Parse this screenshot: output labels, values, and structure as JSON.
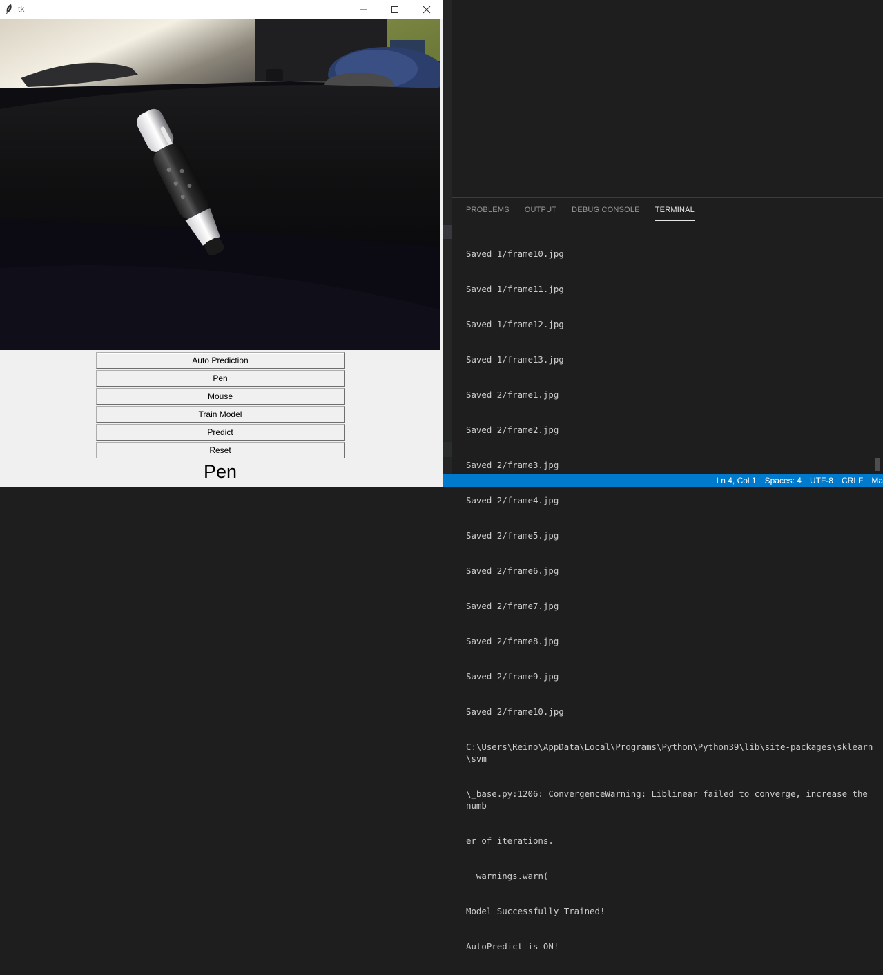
{
  "tk_window": {
    "title": "tk",
    "controls": {
      "minimize": "minimize",
      "maximize": "maximize",
      "close": "close"
    },
    "buttons": [
      {
        "label": "Auto Prediction"
      },
      {
        "label": "Pen"
      },
      {
        "label": "Mouse"
      },
      {
        "label": "Train Model"
      },
      {
        "label": "Predict"
      },
      {
        "label": "Reset"
      }
    ],
    "prediction_label": "Pen",
    "camera_feed": "webcam-preview-pen-on-desk"
  },
  "vscode": {
    "panel_tabs": [
      {
        "label": "PROBLEMS",
        "active": false
      },
      {
        "label": "OUTPUT",
        "active": false
      },
      {
        "label": "DEBUG CONSOLE",
        "active": false
      },
      {
        "label": "TERMINAL",
        "active": true
      }
    ],
    "terminal_lines": [
      "Saved 1/frame10.jpg",
      "Saved 1/frame11.jpg",
      "Saved 1/frame12.jpg",
      "Saved 1/frame13.jpg",
      "Saved 2/frame1.jpg",
      "Saved 2/frame2.jpg",
      "Saved 2/frame3.jpg",
      "Saved 2/frame4.jpg",
      "Saved 2/frame5.jpg",
      "Saved 2/frame6.jpg",
      "Saved 2/frame7.jpg",
      "Saved 2/frame8.jpg",
      "Saved 2/frame9.jpg",
      "Saved 2/frame10.jpg",
      "C:\\Users\\Reino\\AppData\\Local\\Programs\\Python\\Python39\\lib\\site-packages\\sklearn\\svm",
      "\\_base.py:1206: ConvergenceWarning: Liblinear failed to converge, increase the numb",
      "er of iterations.",
      "  warnings.warn(",
      "Model Successfully Trained!",
      "AutoPredict is ON!"
    ],
    "status_bar": {
      "position": "Ln 4, Col 1",
      "spaces": "Spaces: 4",
      "encoding": "UTF-8",
      "eol": "CRLF",
      "language": "Ma"
    },
    "colors": {
      "status_bar": "#007acc",
      "editor_bg": "#1e1e1e",
      "terminal_text": "#cccccc"
    }
  }
}
